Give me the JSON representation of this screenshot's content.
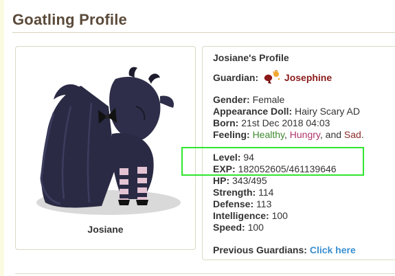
{
  "page": {
    "title": "Goatling Profile"
  },
  "pet": {
    "name": "Josiane"
  },
  "profile": {
    "heading": "Josiane's Profile",
    "guardian_label": "Guardian:",
    "guardian_name": "Josephine",
    "gender_label": "Gender:",
    "gender_value": "Female",
    "appearance_label": "Appearance Doll:",
    "appearance_value": "Hairy Scary AD",
    "born_label": "Born:",
    "born_value": "21st Dec 2018 04:03",
    "feeling_label": "Feeling:",
    "feelings": [
      "Healthy",
      "Hungry",
      "Sad"
    ],
    "feeling_sep1": ",",
    "feeling_sep2": ", and",
    "feeling_end": ".",
    "level_label": "Level:",
    "level_value": "94",
    "exp_label": "EXP:",
    "exp_value": "182052605/461139646",
    "hp_label": "HP:",
    "hp_value": "343/495",
    "strength_label": "Strength:",
    "strength_value": "114",
    "defense_label": "Defense:",
    "defense_value": "113",
    "intelligence_label": "Intelligence:",
    "intelligence_value": "100",
    "speed_label": "Speed:",
    "speed_value": "100",
    "prev_guardians_label": "Previous Guardians:",
    "prev_guardians_link": "Click here"
  },
  "colors": {
    "title": "#5b4a3a",
    "guardian_name": "#8b1a1a",
    "healthy": "#3c8a2e",
    "hungry": "#b0336a",
    "sad": "#8b2a2a",
    "link": "#3a8fd0",
    "highlight": "#2ee62e"
  },
  "icons": {
    "guardian": "guardian-avatar-icon",
    "pet": "goatling-image"
  }
}
